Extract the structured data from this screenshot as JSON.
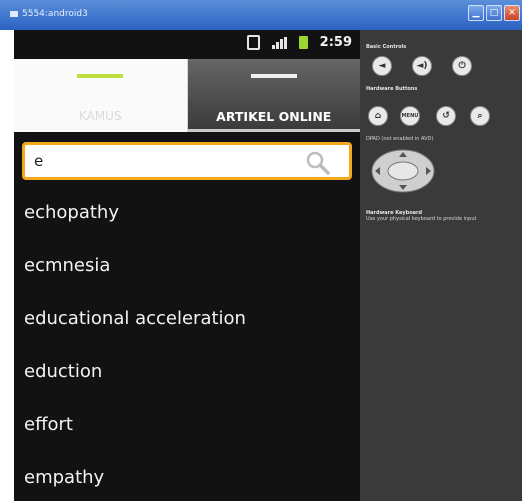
{
  "window": {
    "title": "5554:android3"
  },
  "status": {
    "time": "2:59"
  },
  "tabs": [
    {
      "label": "KAMUS"
    },
    {
      "label": "ARTIKEL ONLINE"
    }
  ],
  "search": {
    "value": "e"
  },
  "results": [
    "echopathy",
    "ecmnesia",
    "educational acceleration",
    "eduction",
    "effort",
    "empathy"
  ],
  "controls": {
    "basic_title": "Basic Controls",
    "hardware_title": "Hardware Buttons",
    "menu_label": "MENU",
    "dpad_title": "DPAD (not enabled in AVD)",
    "keyboard_title": "Hardware Keyboard",
    "keyboard_note": "Use your physical keyboard to provide input"
  },
  "colors": {
    "accent": "#f4a81c",
    "indicator": "#bfe03a",
    "titlebar": "#2a62c4"
  }
}
